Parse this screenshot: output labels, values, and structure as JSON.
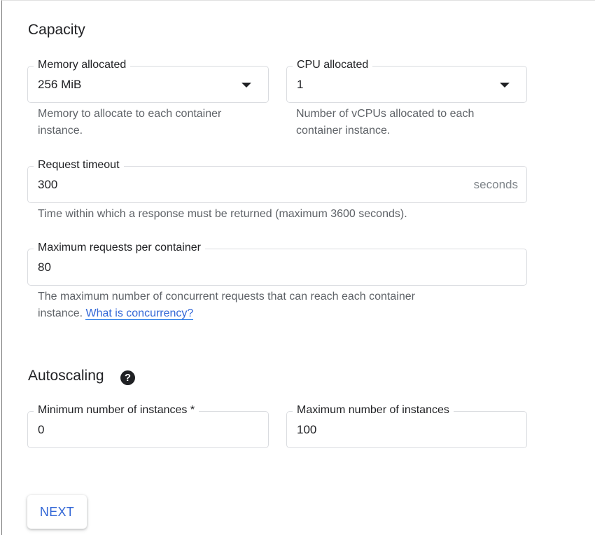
{
  "capacity": {
    "heading": "Capacity",
    "memory": {
      "label": "Memory allocated",
      "value": "256 MiB",
      "helper": "Memory to allocate to each container",
      "helper_line2": "instance."
    },
    "cpu": {
      "label": "CPU allocated",
      "value": "1",
      "helper": "Number of vCPUs allocated to each",
      "helper_line2": "container instance."
    },
    "request_timeout": {
      "label": "Request timeout",
      "value": "300",
      "suffix": "seconds",
      "helper": "Time within which a response must be returned (maximum 3600 seconds)."
    },
    "max_requests": {
      "label": "Maximum requests per container",
      "value": "80",
      "helper": "The maximum number of concurrent requests that can reach each container",
      "helper_line2_prefix": "instance. ",
      "helper_link": "What is concurrency?"
    }
  },
  "autoscaling": {
    "heading": "Autoscaling",
    "help_icon_glyph": "?",
    "min_instances": {
      "label": "Minimum number of instances *",
      "value": "0"
    },
    "max_instances": {
      "label": "Maximum number of instances",
      "value": "100"
    }
  },
  "actions": {
    "next_label": "NEXT"
  },
  "colors": {
    "link": "#3367d6",
    "helper_text": "#5f6368",
    "field_border": "#dadce0"
  }
}
